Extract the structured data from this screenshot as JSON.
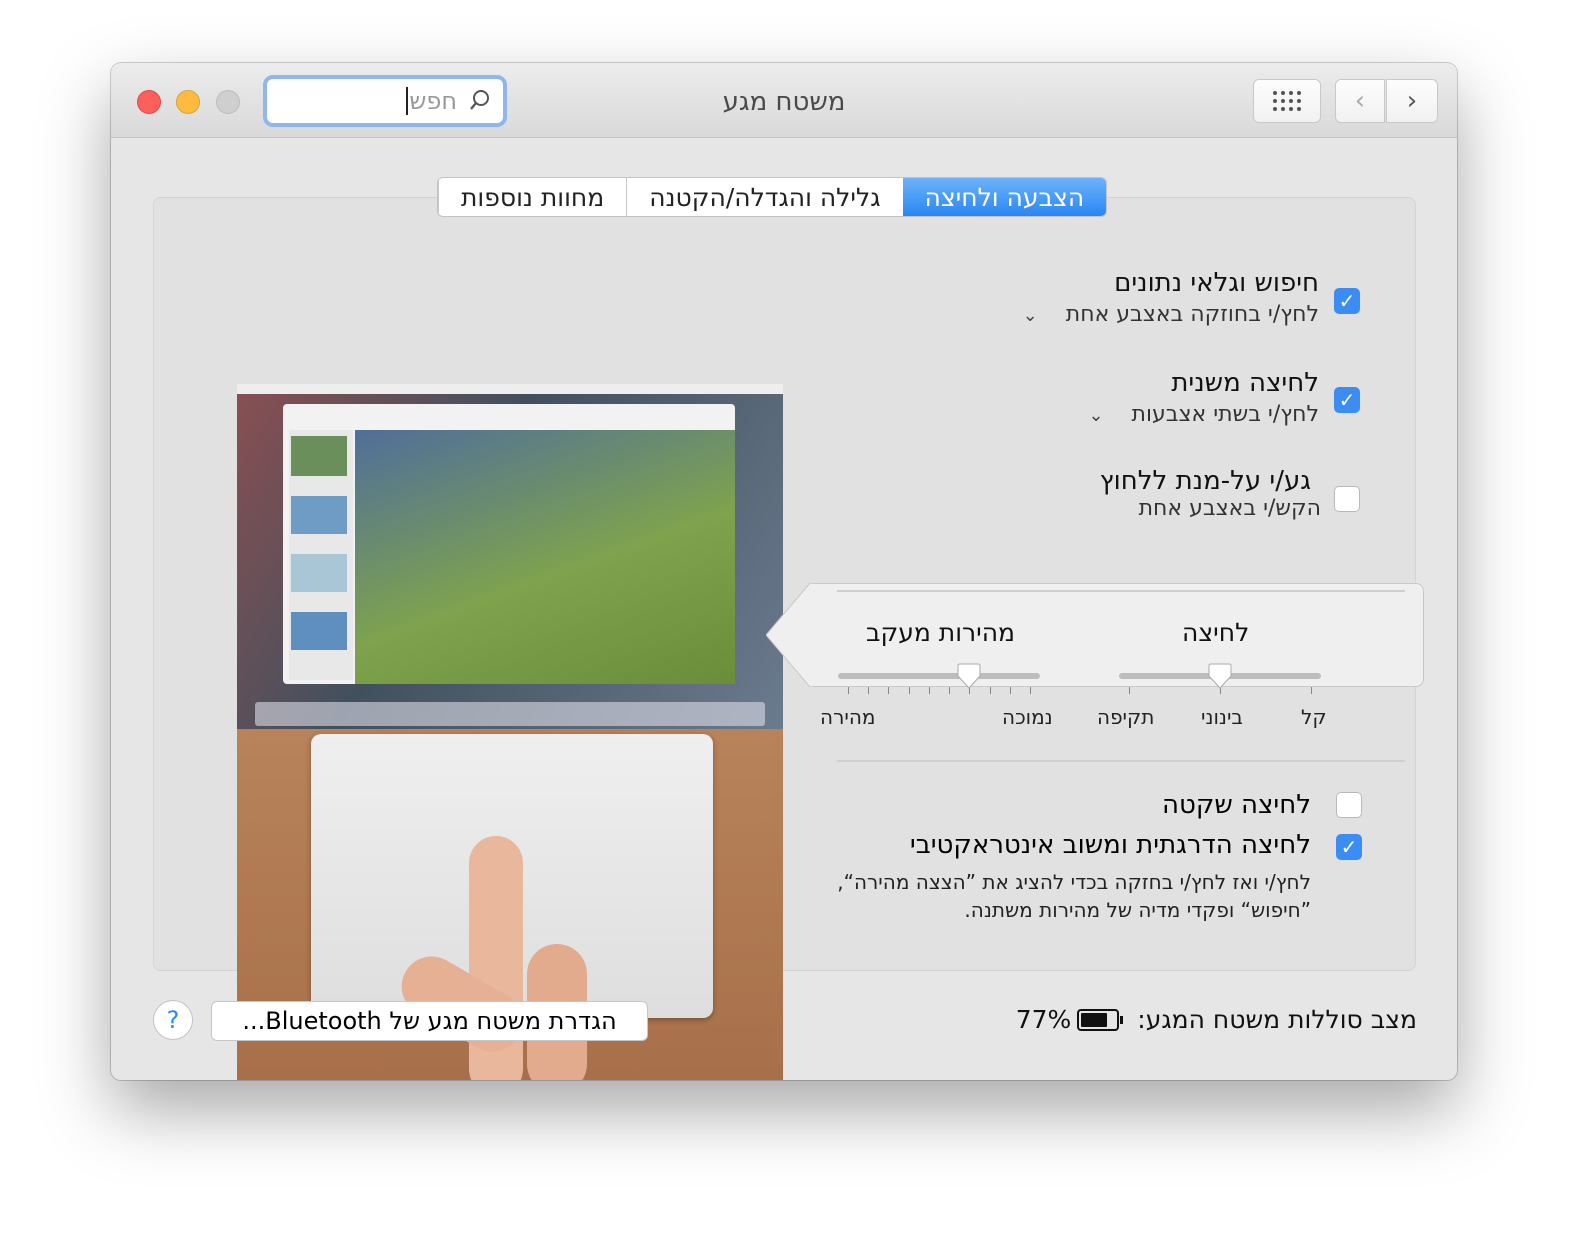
{
  "window": {
    "title": "משטח מגע"
  },
  "search": {
    "value": "חפש",
    "placeholder": "חפש"
  },
  "toolbar": {
    "grid_icon": "show-all-grid-icon",
    "back_icon": "chevron-left-icon",
    "forward_icon": "chevron-right-icon"
  },
  "tabs": [
    {
      "label": "הצבעה ולחיצה",
      "active": true
    },
    {
      "label": "גלילה והגדלה/הקטנה",
      "active": false
    },
    {
      "label": "מחוות נוספות",
      "active": false
    }
  ],
  "options": [
    {
      "title": "חיפוש וגלאי נתונים",
      "subtitle": "לחץ/י בחוזקה באצבע אחת",
      "checked": true,
      "has_dropdown": true
    },
    {
      "title": "לחיצה משנית",
      "subtitle": "לחץ/י בשתי אצבעות",
      "checked": true,
      "has_dropdown": true
    },
    {
      "title": "גע/י על-מנת ללחוץ",
      "subtitle": "הקש/י באצבע אחת",
      "checked": false,
      "has_dropdown": false
    }
  ],
  "sliders": {
    "click": {
      "label": "לחיצה",
      "ticks": [
        "קל",
        "בינוני",
        "תקיפה"
      ],
      "value_fraction": 0.5
    },
    "tracking": {
      "label": "מהירות מעקב",
      "min_label": "נמוכה",
      "max_label": "מהירה",
      "tick_count": 10,
      "value_fraction": 0.667
    }
  },
  "silent_click": {
    "label": "לחיצה שקטה",
    "checked": false
  },
  "force_click": {
    "label": "לחיצה הדרגתית ומשוב אינטראקטיבי",
    "checked": true,
    "description": "לחץ/י ואז לחץ/י בחזקה בכדי להציג את ”הצצה מהירה“, ”חיפוש“ ופקדי מדיה של מהירות משתנה."
  },
  "footer": {
    "battery_label": "מצב סוללות משטח המגע:",
    "battery_percent": "77%",
    "battery_fraction": 0.77,
    "bluetooth_button": "הגדרת משטח מגע של Bluetooth...",
    "help": "?"
  },
  "colors": {
    "accent": "#3b8df3",
    "close": "#fc605c",
    "minimize": "#fdbc40",
    "disabled": "#cfcfcf"
  }
}
